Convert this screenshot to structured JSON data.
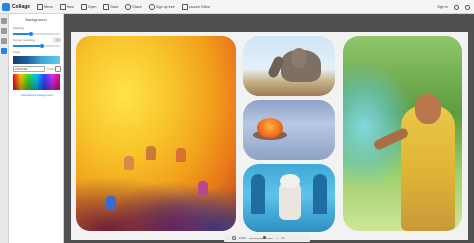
{
  "app": {
    "name": "Collage"
  },
  "toolbar": {
    "items": [
      {
        "label": "Menu"
      },
      {
        "label": "New"
      },
      {
        "label": "Open"
      },
      {
        "label": "Save"
      },
      {
        "label": "Share"
      },
      {
        "label": "Sign up free"
      },
      {
        "label": "Launch Editor"
      }
    ],
    "user_label": "Sign in"
  },
  "rail": {
    "active_index": 3
  },
  "panel": {
    "title": "Background",
    "spacing_label": "Spacing",
    "spacing_value": "",
    "corner_label": "Corner rounding",
    "corner_level": 0.62,
    "color_label": "Color",
    "color_hex": "#1E5F9E",
    "color_value_label": "100%",
    "transparent_label": "Transparent background"
  },
  "zoom": {
    "minus": "–",
    "plus": "+",
    "value": "100%",
    "fit": "Fit"
  },
  "colors": {
    "accent": "#1e88e5",
    "canvas_bg": "#505050",
    "collage_bg": "#f2f2f2"
  },
  "tiles": [
    {
      "name": "holi-hands-photo"
    },
    {
      "name": "elephant-photo"
    },
    {
      "name": "floating-lamp-photo"
    },
    {
      "name": "cow-doorway-photo"
    },
    {
      "name": "woman-blowing-color-photo"
    }
  ]
}
